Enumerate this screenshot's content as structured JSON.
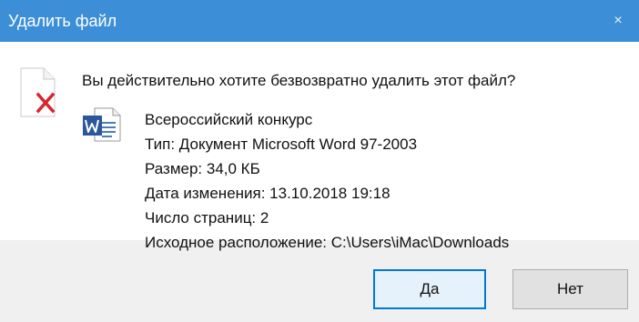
{
  "dialog": {
    "title": "Удалить файл",
    "close_label": "×",
    "question": "Вы действительно хотите безвозвратно удалить этот файл?"
  },
  "file": {
    "name": "Всероссийский конкурс",
    "type": "Тип: Документ Microsoft Word 97-2003",
    "size": "Размер: 34,0 КБ",
    "modified": "Дата изменения: 13.10.2018 19:18",
    "pages": "Число страниц: 2",
    "location": "Исходное расположение: C:\\Users\\iMac\\Downloads"
  },
  "buttons": {
    "yes_label": "Да",
    "no_label": "Нет"
  },
  "icons": {
    "delete": "delete-file-icon",
    "document": "word-document-icon"
  },
  "colors": {
    "titlebar": "#3c8fd6",
    "delete_x": "#d9262c",
    "primary_border": "#0078d7"
  }
}
